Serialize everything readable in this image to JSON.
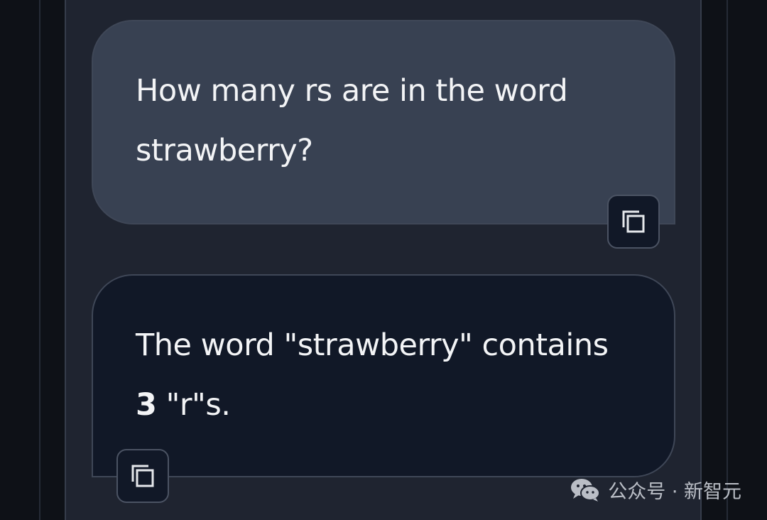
{
  "conversation": {
    "user_message": {
      "line1": "How many rs are in the word",
      "line2": "strawberry?"
    },
    "assistant_message": {
      "line1": "The word \"strawberry\" contains",
      "count": "3",
      "rest": " \"r\"s."
    },
    "copy_icon": "copy-icon"
  },
  "watermark": {
    "text": "公众号 · 新智元",
    "icon": "wechat-icon"
  },
  "colors": {
    "page_bg": "#0e1117",
    "panel_bg": "#1f2430",
    "user_bubble_bg": "#384152",
    "assistant_bubble_bg": "#111827",
    "text": "#f3f4f6"
  }
}
